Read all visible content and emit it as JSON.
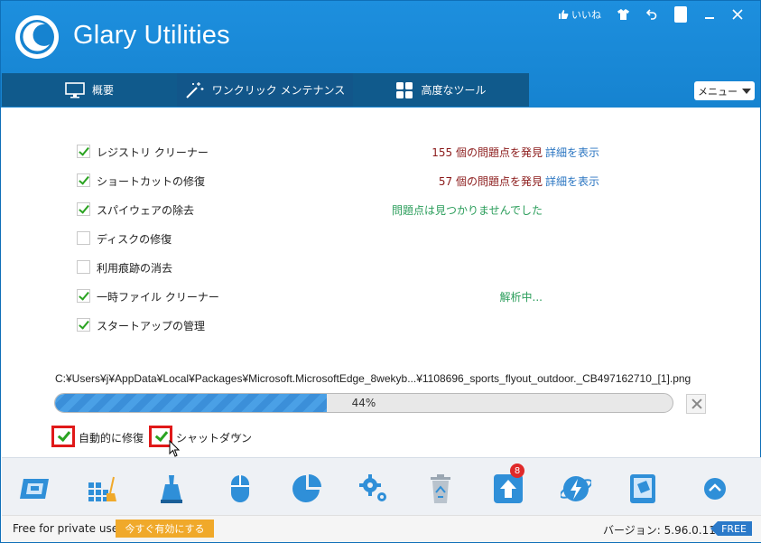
{
  "app": {
    "title": "Glary Utilities"
  },
  "topbar": {
    "like_label": "いいね"
  },
  "tabs": [
    {
      "label": "概要"
    },
    {
      "label": "ワンクリック メンテナンス"
    },
    {
      "label": "高度なツール"
    }
  ],
  "menu": {
    "label": "メニュー"
  },
  "items": [
    {
      "label": "レジストリ クリーナー",
      "checked": true,
      "status": "155 個の問題点を発見",
      "status_color": "red",
      "details": "詳細を表示"
    },
    {
      "label": "ショートカットの修復",
      "checked": true,
      "status": "57 個の問題点を発見",
      "status_color": "red",
      "details": "詳細を表示"
    },
    {
      "label": "スパイウェアの除去",
      "checked": true,
      "status": "問題点は見つかりませんでした",
      "status_color": "green",
      "details": ""
    },
    {
      "label": "ディスクの修復",
      "checked": false,
      "status": "",
      "status_color": "",
      "details": ""
    },
    {
      "label": "利用痕跡の消去",
      "checked": false,
      "status": "",
      "status_color": "",
      "details": ""
    },
    {
      "label": "一時ファイル クリーナー",
      "checked": true,
      "status": "解析中...",
      "status_color": "green",
      "details": ""
    },
    {
      "label": "スタートアップの管理",
      "checked": true,
      "status": "",
      "status_color": "",
      "details": ""
    }
  ],
  "scan": {
    "path": "C:¥Users¥j¥AppData¥Local¥Packages¥Microsoft.MicrosoftEdge_8wekyb...¥1108696_sports_flyout_outdoor._CB497162710_[1].png",
    "progress_percent": 44,
    "progress_label": "44%"
  },
  "options": {
    "auto_repair": "自動的に修復",
    "shutdown": "シャットダウン"
  },
  "toolbar": {
    "update_badge": "8"
  },
  "statusbar": {
    "free_text": "Free for private use",
    "activate_label": "今すぐ有効にする",
    "version": "バージョン: 5.96.0.118",
    "edition": "FREE"
  },
  "colors": {
    "header_blue": "#1683d0",
    "tab_dark": "#105a8c",
    "alert_red": "#8b1a1a",
    "ok_green": "#2a9d5a",
    "link_blue": "#2b76c2",
    "activate_orange": "#f0a92a"
  }
}
